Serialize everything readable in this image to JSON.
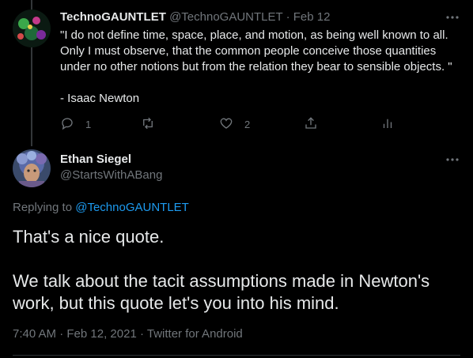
{
  "tweet1": {
    "name": "TechnoGAUNTLET",
    "handle": "@TechnoGAUNTLET",
    "separator": "·",
    "date": "Feb 12",
    "quote": "\"I do not define time, space, place, and motion, as being well known to all. Only I must observe, that the common people conceive those quantities under no other notions but from the relation they bear to sensible objects. \"",
    "attribution": "- Isaac Newton",
    "actions": {
      "reply_count": "1",
      "retweet_count": "",
      "like_count": "2"
    },
    "icons": [
      "reply-icon",
      "retweet-icon",
      "like-icon",
      "share-icon",
      "analytics-icon",
      "more-icon"
    ]
  },
  "tweet2": {
    "name": "Ethan Siegel",
    "handle": "@StartsWithABang",
    "replying_prefix": "Replying to",
    "replying_to": "@TechnoGAUNTLET",
    "paragraph1": "That's a nice quote.",
    "paragraph2": "We talk about the tacit assumptions made in Newton's work, but this quote let's you into his mind.",
    "time": "7:40 AM",
    "separator": "·",
    "date": "Feb 12, 2021",
    "source": "Twitter for Android"
  },
  "colors": {
    "background": "#000000",
    "text": "#e7e9ea",
    "secondary": "#71767b",
    "link": "#1d9bf0"
  }
}
